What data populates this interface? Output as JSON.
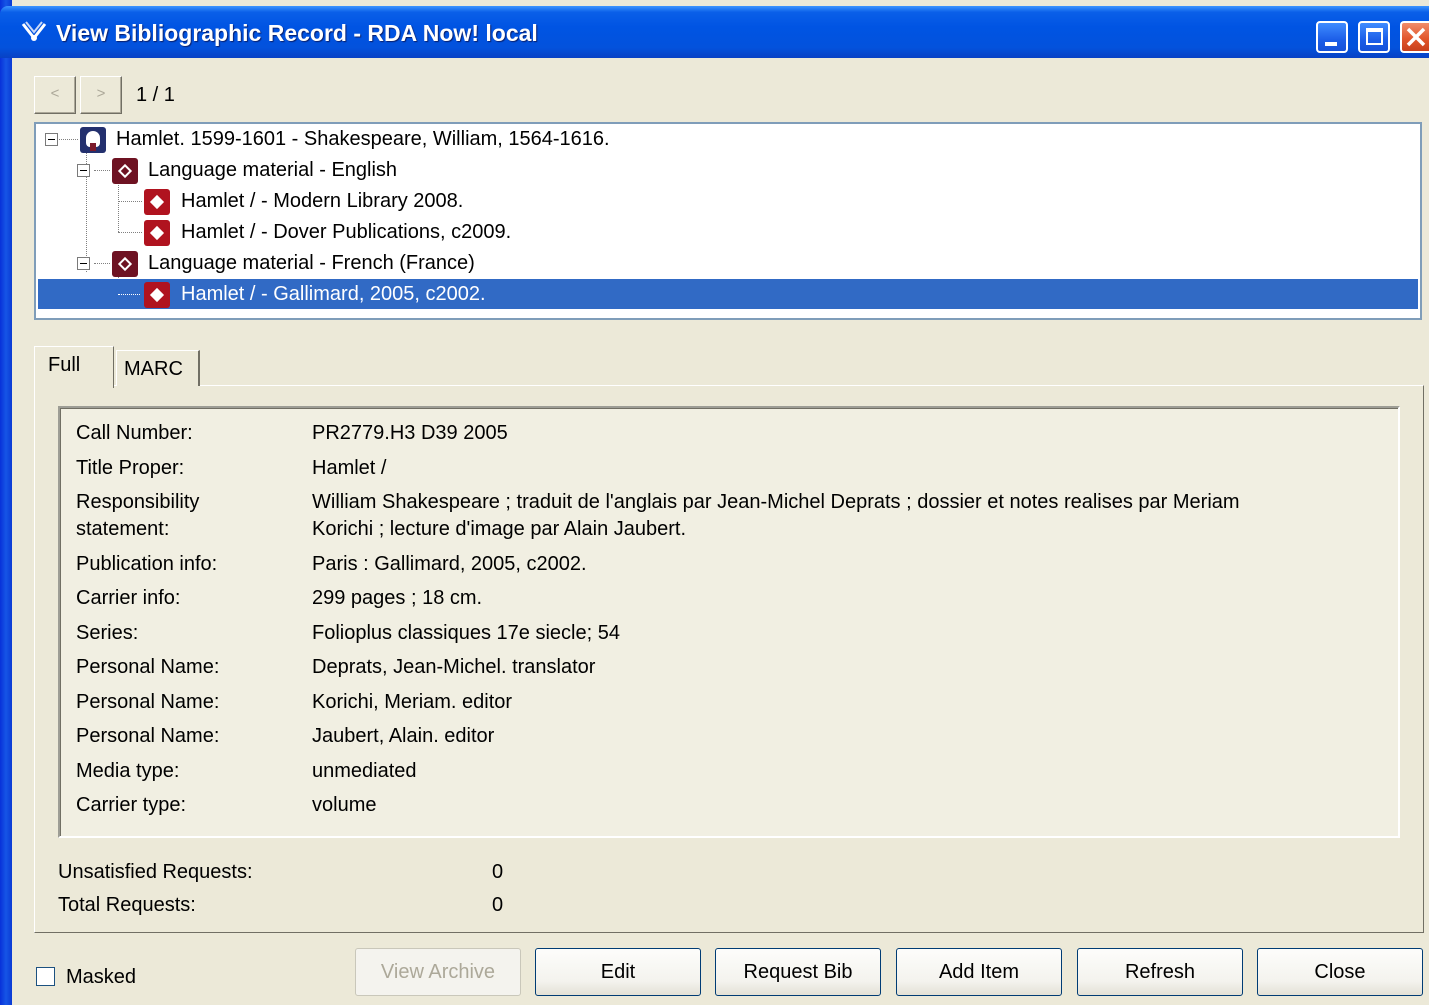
{
  "window": {
    "title": "View Bibliographic Record - RDA Now! local"
  },
  "nav": {
    "prev": "<",
    "next": ">",
    "count": "1 / 1"
  },
  "tree": {
    "work": "Hamlet. 1599-1601 - Shakespeare, William, 1564-1616.",
    "expr1": "Language material - English",
    "manif1": "Hamlet / - Modern Library 2008.",
    "manif2": "Hamlet / - Dover Publications, c2009.",
    "expr2": "Language material - French (France)",
    "manif3": "Hamlet / - Gallimard, 2005, c2002."
  },
  "tabs": {
    "full": "Full",
    "marc": "MARC"
  },
  "details": {
    "call_number_label": "Call Number:",
    "call_number": "PR2779.H3 D39 2005",
    "title_label": "Title Proper:",
    "title": "Hamlet /",
    "resp_label_1": "Responsibility",
    "resp_label_2": "statement:",
    "resp_1": "William Shakespeare ; traduit de l'anglais par Jean-Michel Deprats ; dossier et notes realises par Meriam",
    "resp_2": "Korichi ; lecture d'image par Alain Jaubert.",
    "pub_label": "Publication info:",
    "pub": "Paris : Gallimard, 2005, c2002.",
    "carrier_info_label": "Carrier info:",
    "carrier_info": "299 pages ; 18 cm.",
    "series_label": "Series:",
    "series": "Folioplus classiques 17e siecle; 54",
    "pn_label": "Personal Name:",
    "pn1": "Deprats, Jean-Michel. translator",
    "pn2": "Korichi, Meriam. editor",
    "pn3": "Jaubert, Alain. editor",
    "media_label": "Media type:",
    "media": "unmediated",
    "carrier_type_label": "Carrier type:",
    "carrier_type": "volume"
  },
  "requests": {
    "unsatisfied_label": "Unsatisfied Requests:",
    "unsatisfied": "0",
    "total_label": "Total Requests:",
    "total": "0"
  },
  "footer": {
    "masked_label": "Masked",
    "masked_checked": false,
    "view_archive": "View Archive",
    "edit": "Edit",
    "request_bib": "Request Bib",
    "add_item": "Add Item",
    "refresh": "Refresh",
    "close": "Close"
  },
  "colors": {
    "titlebar": "#0054e3",
    "selection": "#316ac5",
    "record_icon": "#b0131f"
  }
}
